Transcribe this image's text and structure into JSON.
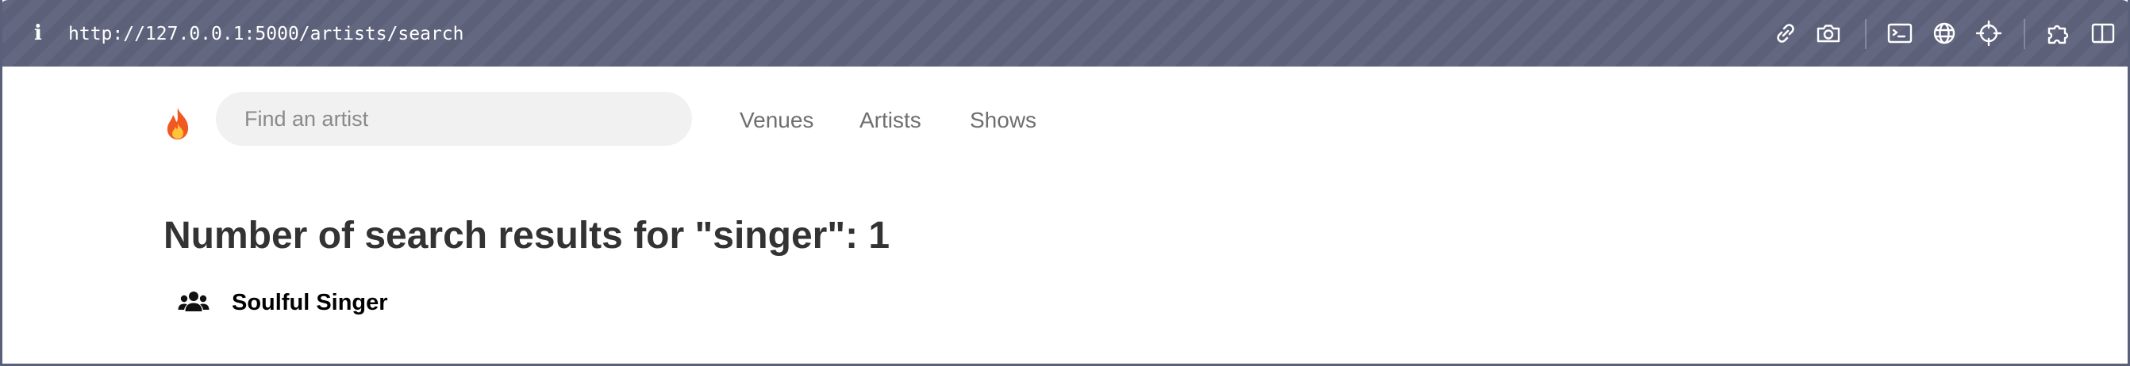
{
  "browser": {
    "url": "http://127.0.0.1:5000/artists/search",
    "info_icon_glyph": "i",
    "toolbar_icons": [
      "link-icon",
      "camera-icon",
      "terminal-icon",
      "globe-icon",
      "crosshair-icon",
      "puzzle-icon",
      "sidebar-icon"
    ],
    "bar_color": "#5c6079"
  },
  "navbar": {
    "brand_icon": "fire-icon",
    "search": {
      "placeholder": "Find an artist",
      "value": ""
    },
    "links": [
      "Venues",
      "Artists",
      "Shows"
    ]
  },
  "results": {
    "heading": "Number of search results for \"singer\": 1",
    "items": [
      {
        "icon": "users-icon",
        "name": "Soulful Singer"
      }
    ]
  }
}
